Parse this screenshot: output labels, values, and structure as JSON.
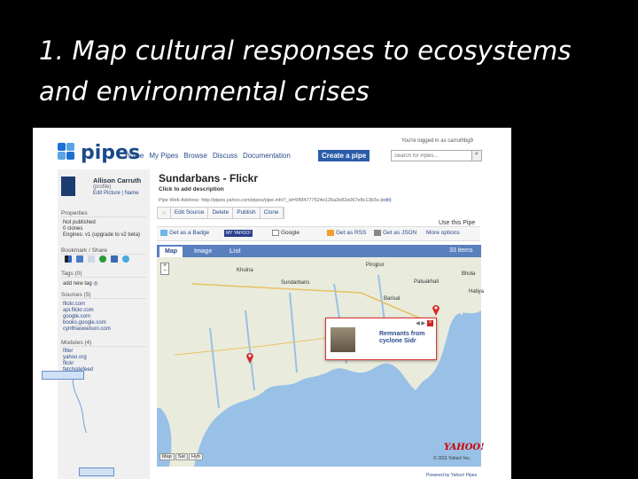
{
  "slide": {
    "title": "1. Map cultural responses to ecosystems and environmental crises"
  },
  "pipes": {
    "logo_text": "pipes",
    "nav": [
      "Home",
      "My Pipes",
      "Browse",
      "Discuss",
      "Documentation"
    ],
    "create_label": "Create a pipe",
    "logged_in": "You're logged in as carruthbg9",
    "search_placeholder": "Search for Pipes...",
    "user": {
      "name": "Allison Carruth",
      "sub": "(profile)",
      "links": "Edit Picture | Name"
    },
    "properties": {
      "head": "Properties",
      "lines": [
        "Not published",
        "0 clones",
        "Engines: v1 (upgrade to v2 beta)"
      ]
    },
    "bookmark_head": "Bookmark / Share",
    "tags": {
      "head": "Tags (0)",
      "add": "add new tag"
    },
    "sources": {
      "head": "Sources (5)",
      "items": [
        "flickr.com",
        "api.flickr.com",
        "google.com",
        "books.google.com",
        "cynthiaswelson.com"
      ]
    },
    "modules": {
      "head": "Modules (4)",
      "items": [
        "filter",
        "yahoo.org",
        "flickr",
        "fetchsitefeed"
      ]
    },
    "pipe_title": "Sundarbans - Flickr",
    "description": "Click to add description",
    "web_address_label": "Pipe Web Address:",
    "web_address": "http://pipes.yahoo.com/pipes/pipe.info?_id=5f6f4777524e126a3e82a067e8c13b3a",
    "web_address_link": "(edit)",
    "actions": [
      "Edit Source",
      "Delete",
      "Publish",
      "Clone"
    ],
    "use_label": "Use this Pipe",
    "use_options": [
      "Get as a Badge",
      "MY YAHOO!",
      "Google",
      "Get as RSS",
      "Get as JSON",
      "More options"
    ],
    "tabs": [
      "Map",
      "Image",
      "List"
    ],
    "items_count": "33 items",
    "map": {
      "labels": [
        "Pirojpur",
        "Patuakhali",
        "Barisal",
        "Bhola",
        "Sundarbans",
        "Khulna",
        "Hatiya"
      ],
      "popup_text": "Remnants from cyclone Sidr",
      "popup_nav": "◀ ▶",
      "modes": [
        "Map",
        "Sat",
        "Hyb"
      ],
      "brand": "YAHOO!",
      "copyright": "© 2011 Yahoo! Inc."
    },
    "footer_link": "Powered by Yahoo! Pipes"
  },
  "colors": {
    "brand_blue": "#2a5ca8",
    "tab_blue": "#5a7fbf",
    "land": "#e9ecdc",
    "water": "#99c0e6"
  }
}
